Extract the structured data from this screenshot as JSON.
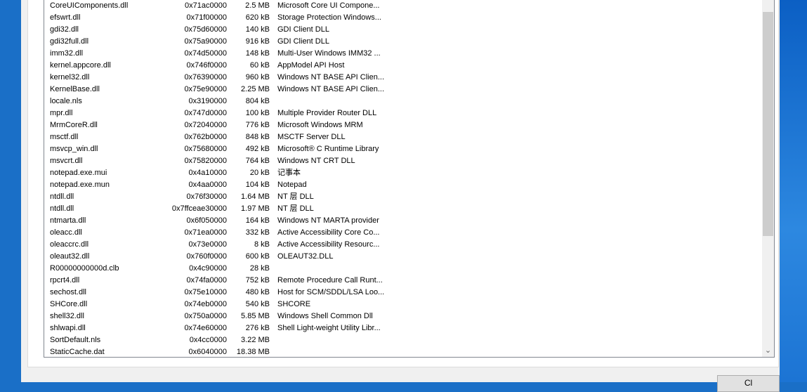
{
  "modules": [
    {
      "name": "CoreUIComponents.dll",
      "base": "0x71ac0000",
      "size": "2.5 MB",
      "description": "Microsoft Core UI Compone..."
    },
    {
      "name": "efswrt.dll",
      "base": "0x71f00000",
      "size": "620 kB",
      "description": "Storage Protection Windows..."
    },
    {
      "name": "gdi32.dll",
      "base": "0x75d60000",
      "size": "140 kB",
      "description": "GDI Client DLL"
    },
    {
      "name": "gdi32full.dll",
      "base": "0x75a90000",
      "size": "916 kB",
      "description": "GDI Client DLL"
    },
    {
      "name": "imm32.dll",
      "base": "0x74d50000",
      "size": "148 kB",
      "description": "Multi-User Windows IMM32 ..."
    },
    {
      "name": "kernel.appcore.dll",
      "base": "0x746f0000",
      "size": "60 kB",
      "description": "AppModel API Host"
    },
    {
      "name": "kernel32.dll",
      "base": "0x76390000",
      "size": "960 kB",
      "description": "Windows NT BASE API Clien..."
    },
    {
      "name": "KernelBase.dll",
      "base": "0x75e90000",
      "size": "2.25 MB",
      "description": "Windows NT BASE API Clien..."
    },
    {
      "name": "locale.nls",
      "base": "0x3190000",
      "size": "804 kB",
      "description": ""
    },
    {
      "name": "mpr.dll",
      "base": "0x747d0000",
      "size": "100 kB",
      "description": "Multiple Provider Router DLL"
    },
    {
      "name": "MrmCoreR.dll",
      "base": "0x72040000",
      "size": "776 kB",
      "description": "Microsoft Windows MRM"
    },
    {
      "name": "msctf.dll",
      "base": "0x762b0000",
      "size": "848 kB",
      "description": "MSCTF Server DLL"
    },
    {
      "name": "msvcp_win.dll",
      "base": "0x75680000",
      "size": "492 kB",
      "description": "Microsoft® C Runtime Library"
    },
    {
      "name": "msvcrt.dll",
      "base": "0x75820000",
      "size": "764 kB",
      "description": "Windows NT CRT DLL"
    },
    {
      "name": "notepad.exe.mui",
      "base": "0x4a10000",
      "size": "20 kB",
      "description": "记事本"
    },
    {
      "name": "notepad.exe.mun",
      "base": "0x4aa0000",
      "size": "104 kB",
      "description": "Notepad"
    },
    {
      "name": "ntdll.dll",
      "base": "0x76f30000",
      "size": "1.64 MB",
      "description": "NT 层 DLL"
    },
    {
      "name": "ntdll.dll",
      "base": "0x7ffceae30000",
      "size": "1.97 MB",
      "description": "NT 层 DLL"
    },
    {
      "name": "ntmarta.dll",
      "base": "0x6f050000",
      "size": "164 kB",
      "description": "Windows NT MARTA provider"
    },
    {
      "name": "oleacc.dll",
      "base": "0x71ea0000",
      "size": "332 kB",
      "description": "Active Accessibility Core Co..."
    },
    {
      "name": "oleaccrc.dll",
      "base": "0x73e0000",
      "size": "8 kB",
      "description": "Active Accessibility Resourc..."
    },
    {
      "name": "oleaut32.dll",
      "base": "0x760f0000",
      "size": "600 kB",
      "description": "OLEAUT32.DLL"
    },
    {
      "name": "R00000000000d.clb",
      "base": "0x4c90000",
      "size": "28 kB",
      "description": ""
    },
    {
      "name": "rpcrt4.dll",
      "base": "0x74fa0000",
      "size": "752 kB",
      "description": "Remote Procedure Call Runt..."
    },
    {
      "name": "sechost.dll",
      "base": "0x75e10000",
      "size": "480 kB",
      "description": "Host for SCM/SDDL/LSA Loo..."
    },
    {
      "name": "SHCore.dll",
      "base": "0x74eb0000",
      "size": "540 kB",
      "description": "SHCORE"
    },
    {
      "name": "shell32.dll",
      "base": "0x750a0000",
      "size": "5.85 MB",
      "description": "Windows Shell Common Dll"
    },
    {
      "name": "shlwapi.dll",
      "base": "0x74e60000",
      "size": "276 kB",
      "description": "Shell Light-weight Utility Libr..."
    },
    {
      "name": "SortDefault.nls",
      "base": "0x4cc0000",
      "size": "3.22 MB",
      "description": ""
    },
    {
      "name": "StaticCache.dat",
      "base": "0x6040000",
      "size": "18.38 MB",
      "description": ""
    }
  ],
  "scrollbar": {
    "down_arrow": "⌄"
  },
  "bottom_button": {
    "label": "Cl"
  },
  "colors": {
    "desktop": "#1a6fc7",
    "window": "#f0f0f0",
    "list_bg": "#ffffff"
  }
}
